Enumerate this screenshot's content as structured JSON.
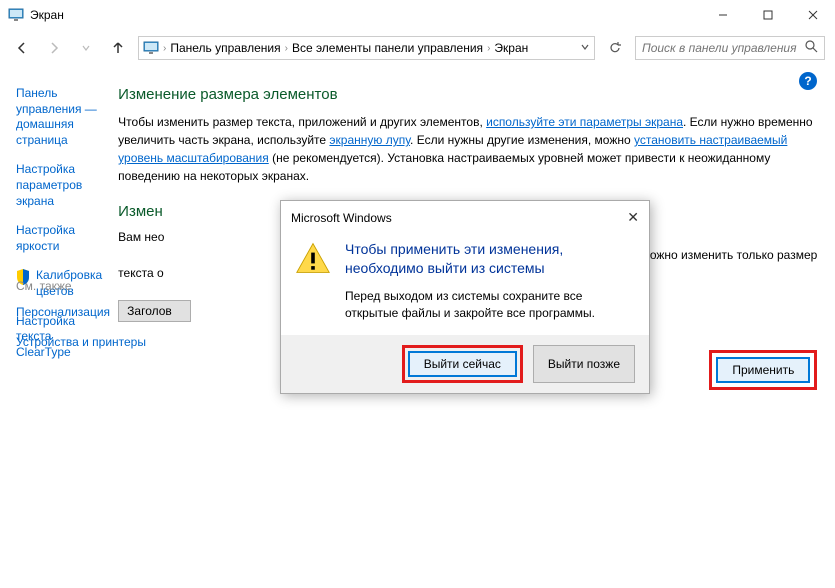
{
  "window": {
    "title": "Экран"
  },
  "breadcrumbs": {
    "items": [
      "Панель управления",
      "Все элементы панели управления",
      "Экран"
    ]
  },
  "search": {
    "placeholder": "Поиск в панели управления"
  },
  "sidebar": {
    "items": [
      "Панель управления — домашняя страница",
      "Настройка параметров экрана",
      "Настройка яркости",
      "Калибровка цветов",
      "Настройка текста ClearType"
    ]
  },
  "seealso": {
    "heading": "См. также",
    "items": [
      "Персонализация",
      "Устройства и принтеры"
    ]
  },
  "main": {
    "heading": "Изменение размера элементов",
    "para_pre": "Чтобы изменить размер текста, приложений и других элементов, ",
    "link1": "используйте эти параметры экрана",
    "para_mid1": ". Если нужно временно увеличить часть экрана, используйте ",
    "link2": "экранную лупу",
    "para_mid2": ". Если нужны другие изменения, можно ",
    "link3": "установить настраиваемый уровень масштабирования",
    "para_post": " (не рекомендуется). Установка настраиваемых уровней может привести к неожиданному поведению на некоторых экранах.",
    "heading2_visible": "Измен",
    "para2_line1": "Вам нео",
    "para2_line2": "текста о",
    "para2_trail": "                                                                                                                                                             можно изменить только размер",
    "dropdown_label": "Заголов",
    "apply": "Применить"
  },
  "dialog": {
    "title": "Microsoft Windows",
    "heading": "Чтобы применить эти изменения, необходимо выйти из системы",
    "text": "Перед выходом из системы сохраните все открытые файлы и закройте все программы.",
    "primary": "Выйти сейчас",
    "secondary": "Выйти позже"
  }
}
